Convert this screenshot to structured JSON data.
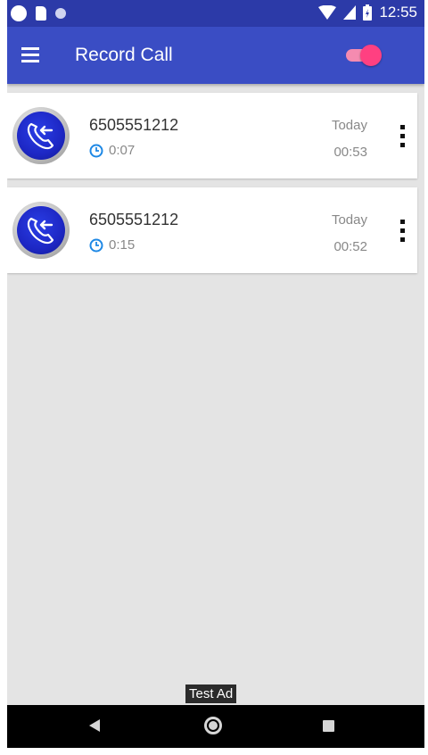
{
  "status_bar": {
    "time": "12:55",
    "icons": [
      "notification-dot-icon",
      "sd-card-icon",
      "notification-dot-icon",
      "wifi-icon",
      "signal-icon",
      "battery-icon"
    ]
  },
  "app_bar": {
    "title": "Record Call",
    "menu_icon": "hamburger-menu-icon",
    "recording_toggle": {
      "on": true,
      "thumb_color": "#ff4081"
    },
    "color": "#3a4dc4"
  },
  "calls": [
    {
      "number": "6505551212",
      "duration": "0:07",
      "day": "Today",
      "time": "00:53",
      "icon": "incoming-call-icon"
    },
    {
      "number": "6505551212",
      "duration": "0:15",
      "day": "Today",
      "time": "00:52",
      "icon": "incoming-call-icon"
    }
  ],
  "ad": {
    "label": "Test Ad"
  },
  "nav_bar": {
    "icons": [
      "back-icon",
      "home-icon",
      "recents-icon"
    ]
  },
  "colors": {
    "primary": "#3a4dc4",
    "primary_dark": "#2c3aa8",
    "accent": "#ff4081",
    "clock_icon": "#1e88e5"
  }
}
